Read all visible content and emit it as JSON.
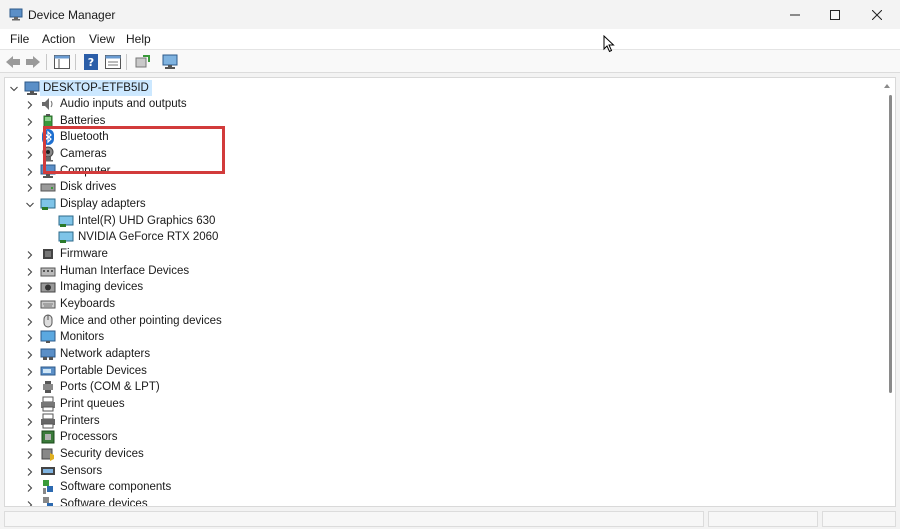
{
  "window": {
    "title": "Device Manager"
  },
  "menu": [
    {
      "label": "File"
    },
    {
      "label": "Action"
    },
    {
      "label": "View"
    },
    {
      "label": "Help"
    }
  ],
  "tree": {
    "root": "DESKTOP-ETFB5ID",
    "categories": [
      {
        "label": "Audio inputs and outputs",
        "icon": "speaker-icon",
        "expanded": false
      },
      {
        "label": "Batteries",
        "icon": "battery-icon",
        "expanded": false
      },
      {
        "label": "Bluetooth",
        "icon": "bluetooth-icon",
        "expanded": false
      },
      {
        "label": "Cameras",
        "icon": "camera-icon",
        "expanded": false
      },
      {
        "label": "Computer",
        "icon": "computer-icon",
        "expanded": false
      },
      {
        "label": "Disk drives",
        "icon": "disk-drive-icon",
        "expanded": false
      },
      {
        "label": "Display adapters",
        "icon": "display-adapter-icon",
        "expanded": true,
        "children": [
          {
            "label": "Intel(R) UHD Graphics 630",
            "icon": "display-adapter-icon"
          },
          {
            "label": "NVIDIA GeForce RTX 2060",
            "icon": "display-adapter-icon"
          }
        ]
      },
      {
        "label": "Firmware",
        "icon": "firmware-icon",
        "expanded": false
      },
      {
        "label": "Human Interface Devices",
        "icon": "hid-icon",
        "expanded": false
      },
      {
        "label": "Imaging devices",
        "icon": "imaging-icon",
        "expanded": false
      },
      {
        "label": "Keyboards",
        "icon": "keyboard-icon",
        "expanded": false
      },
      {
        "label": "Mice and other pointing devices",
        "icon": "mouse-icon",
        "expanded": false
      },
      {
        "label": "Monitors",
        "icon": "monitor-icon",
        "expanded": false
      },
      {
        "label": "Network adapters",
        "icon": "network-adapter-icon",
        "expanded": false
      },
      {
        "label": "Portable Devices",
        "icon": "portable-device-icon",
        "expanded": false
      },
      {
        "label": "Ports (COM & LPT)",
        "icon": "port-icon",
        "expanded": false
      },
      {
        "label": "Print queues",
        "icon": "print-queue-icon",
        "expanded": false
      },
      {
        "label": "Printers",
        "icon": "printer-icon",
        "expanded": false
      },
      {
        "label": "Processors",
        "icon": "processor-icon",
        "expanded": false
      },
      {
        "label": "Security devices",
        "icon": "security-device-icon",
        "expanded": false
      },
      {
        "label": "Sensors",
        "icon": "sensor-icon",
        "expanded": false
      },
      {
        "label": "Software components",
        "icon": "software-component-icon",
        "expanded": false
      },
      {
        "label": "Software devices",
        "icon": "software-device-icon",
        "expanded": false
      }
    ]
  },
  "colors": {
    "highlight_border": "#d23b3b",
    "selection_bg": "#cce8ff"
  }
}
